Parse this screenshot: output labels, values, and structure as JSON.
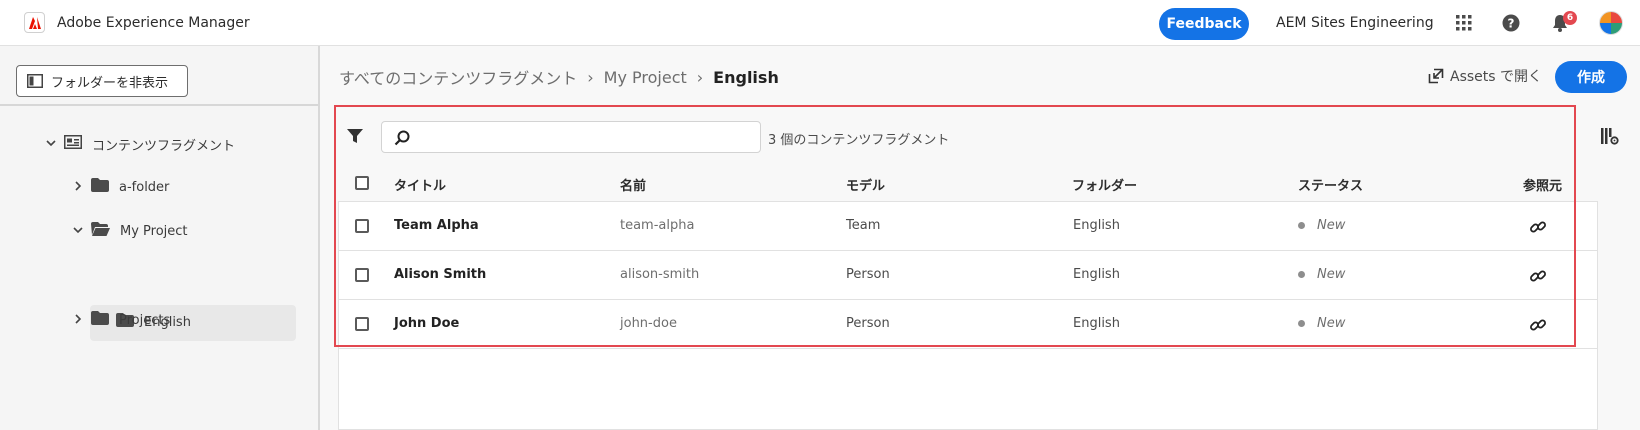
{
  "app": {
    "title": "Adobe Experience Manager"
  },
  "header": {
    "feedback_label": "Feedback",
    "org_name": "AEM Sites Engineering",
    "notification_count": "6"
  },
  "sidebar": {
    "hide_folder_label": "フォルダーを非表示",
    "tree": {
      "root": "コンテンツフラグメント",
      "items": [
        "a-folder",
        "My Project",
        "English",
        "Projects"
      ]
    }
  },
  "breadcrumb": {
    "items": [
      "すべてのコンテンツフラグメント",
      "My Project",
      "English"
    ]
  },
  "toolbar": {
    "open_assets_label": "Assets で開く",
    "create_label": "作成",
    "search_placeholder": "",
    "count_label": "3 個のコンテンツフラグメント"
  },
  "table": {
    "columns": [
      "タイトル",
      "名前",
      "モデル",
      "フォルダー",
      "ステータス",
      "参照元"
    ],
    "rows": [
      {
        "title": "Team Alpha",
        "name": "team-alpha",
        "model": "Team",
        "folder": "English",
        "status": "New"
      },
      {
        "title": "Alison Smith",
        "name": "alison-smith",
        "model": "Person",
        "folder": "English",
        "status": "New"
      },
      {
        "title": "John Doe",
        "name": "john-doe",
        "model": "Person",
        "folder": "English",
        "status": "New"
      }
    ]
  },
  "colors": {
    "accent": "#1473e6",
    "highlight": "#e34850"
  },
  "icons": [
    "adobe-logo-icon",
    "apps-grid-icon",
    "help-icon",
    "bell-icon",
    "panel-icon",
    "chevron-down-icon",
    "chevron-right-icon",
    "folder-icon",
    "folder-open-icon",
    "fragment-icon",
    "open-external-icon",
    "filter-icon",
    "search-icon",
    "column-settings-icon",
    "link-icon"
  ]
}
